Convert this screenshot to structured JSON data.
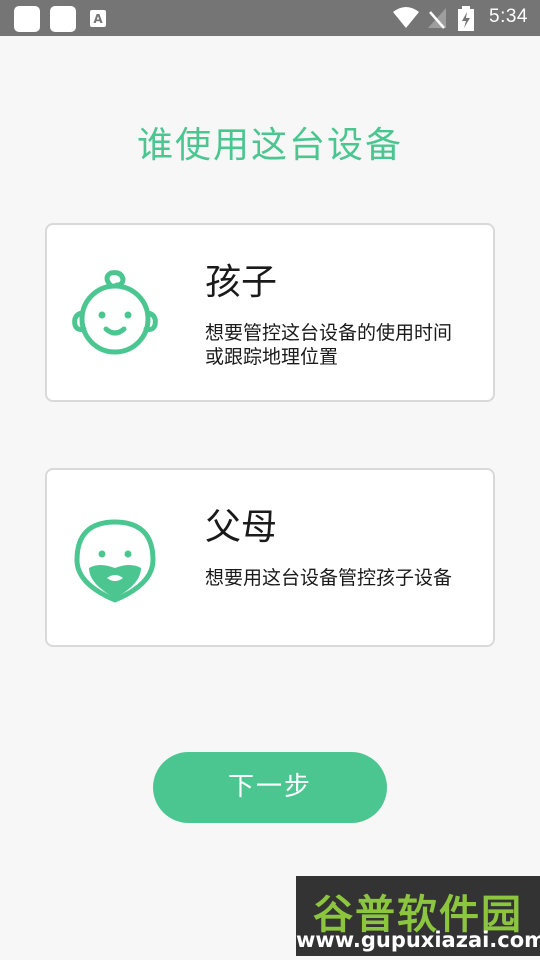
{
  "status_bar": {
    "time": "5:34",
    "left_icons": [
      "notification-square-icon",
      "notification-square-icon",
      "a-badge-icon"
    ],
    "a_badge": "A",
    "right_icons": [
      "wifi-icon",
      "no-signal-icon",
      "battery-charging-icon"
    ]
  },
  "page": {
    "title": "谁使用这台设备"
  },
  "options": {
    "child": {
      "title": "孩子",
      "desc_line1": "想要管控这台设备的使用时间",
      "desc_line2": "或跟踪地理位置",
      "icon": "baby-face-icon"
    },
    "parent": {
      "title": "父母",
      "desc": "想要用这台设备管控孩子设备",
      "icon": "bearded-face-icon"
    }
  },
  "actions": {
    "next_label": "下一步"
  },
  "watermark": {
    "brand": "谷普软件园",
    "url": "www.gupuxiazai.com"
  },
  "colors": {
    "accent": "#4cc690",
    "status_bar": "#757575",
    "background": "#f8f7f7"
  }
}
